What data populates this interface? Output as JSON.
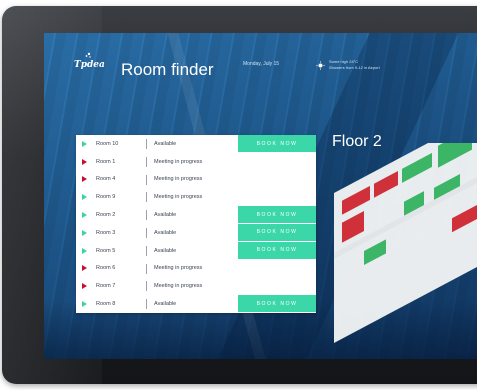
{
  "header": {
    "logo": "Tpdea",
    "title": "Room finder",
    "date": "Monday, July 15",
    "weather_line1": "Some high 24°C",
    "weather_line2": "Showers from 9-12 in Airport"
  },
  "floor_label": "Floor 2",
  "colors": {
    "available": "#3ad3a5",
    "busy": "#c8102e",
    "book_button": "#3bd7a9"
  },
  "rooms": [
    {
      "name": "Room 10",
      "status": "Available",
      "state": "available",
      "action": "BOOK NOW"
    },
    {
      "name": "Room 1",
      "status": "Meeting in progress",
      "state": "busy",
      "action": ""
    },
    {
      "name": "Room 4",
      "status": "Meeting in progress",
      "state": "busy",
      "action": ""
    },
    {
      "name": "Room 9",
      "status": "Meeting in progress",
      "state": "available",
      "action": ""
    },
    {
      "name": "Room 2",
      "status": "Available",
      "state": "available",
      "action": "BOOK NOW"
    },
    {
      "name": "Room 3",
      "status": "Available",
      "state": "available",
      "action": "BOOK NOW"
    },
    {
      "name": "Room 5",
      "status": "Available",
      "state": "available",
      "action": "BOOK NOW"
    },
    {
      "name": "Room 6",
      "status": "Meeting in progress",
      "state": "busy",
      "action": ""
    },
    {
      "name": "Room 7",
      "status": "Meeting in progress",
      "state": "busy",
      "action": ""
    },
    {
      "name": "Room 8",
      "status": "Available",
      "state": "available",
      "action": "BOOK NOW"
    }
  ],
  "icons": {
    "weather": "sun-icon",
    "available_marker": "play-flag-icon",
    "busy_marker": "play-flag-icon"
  }
}
